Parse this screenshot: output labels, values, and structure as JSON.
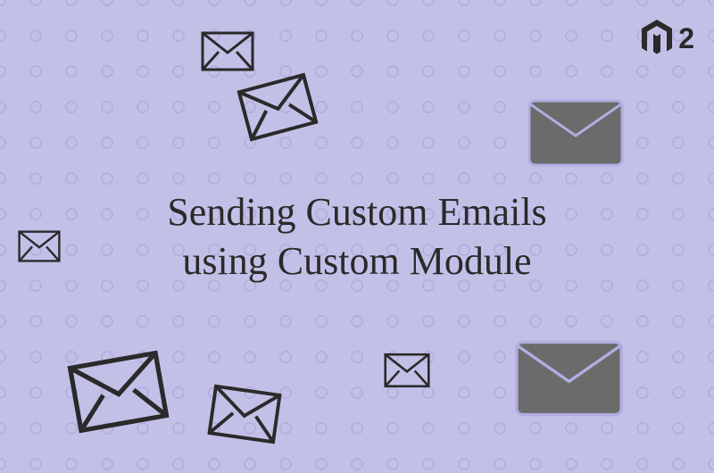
{
  "title_line1": "Sending Custom Emails",
  "title_line2": "using Custom Module",
  "logo_version": "2"
}
